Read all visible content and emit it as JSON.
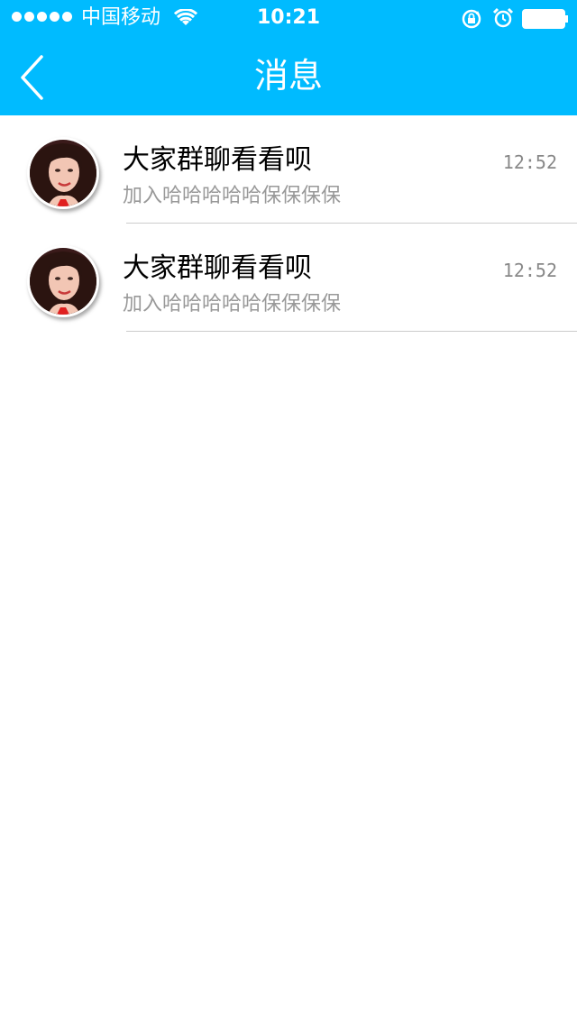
{
  "status_bar": {
    "carrier": "中国移动",
    "time": "10:21",
    "signal_bars": 5,
    "icons": [
      "wifi-icon",
      "rotation-lock-icon",
      "alarm-icon",
      "battery-icon"
    ]
  },
  "nav": {
    "title": "消息",
    "back_icon": "chevron-left-icon"
  },
  "messages": [
    {
      "title": "大家群聊看看呗",
      "subtitle": "加入哈哈哈哈哈保保保保",
      "time": "12:52"
    },
    {
      "title": "大家群聊看看呗",
      "subtitle": "加入哈哈哈哈哈保保保保",
      "time": "12:52"
    }
  ],
  "colors": {
    "accent": "#00bbff",
    "title_text": "#000000",
    "subtitle_text": "#999999",
    "time_text": "#888888",
    "divider": "#cccccc"
  }
}
